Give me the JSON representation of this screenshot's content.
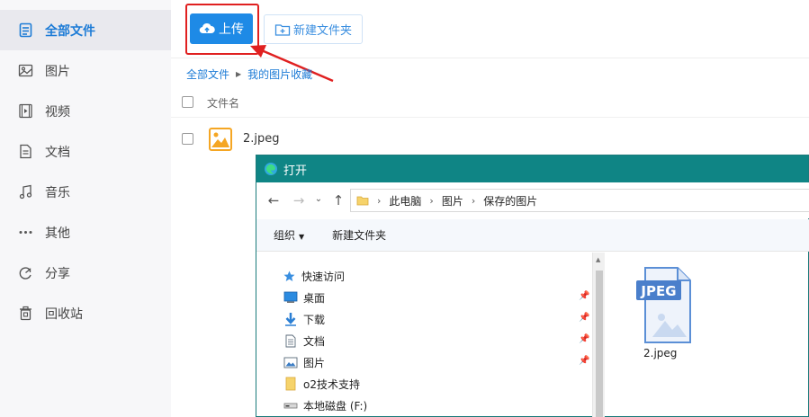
{
  "sidebar": {
    "items": [
      {
        "label": "全部文件",
        "icon": "document-icon",
        "active": true
      },
      {
        "label": "图片",
        "icon": "image-icon"
      },
      {
        "label": "视频",
        "icon": "video-icon"
      },
      {
        "label": "文档",
        "icon": "file-text-icon"
      },
      {
        "label": "音乐",
        "icon": "music-icon"
      },
      {
        "label": "其他",
        "icon": "more-icon"
      },
      {
        "label": "分享",
        "icon": "share-icon"
      },
      {
        "label": "回收站",
        "icon": "trash-icon"
      }
    ]
  },
  "toolbar": {
    "upload_label": "上传",
    "new_folder_label": "新建文件夹"
  },
  "breadcrumb": [
    "全部文件",
    "我的图片收藏"
  ],
  "file_list": {
    "column_name": "文件名",
    "files": [
      {
        "name": "2.jpeg"
      }
    ]
  },
  "dialog": {
    "title": "打开",
    "address": [
      "此电脑",
      "图片",
      "保存的图片"
    ],
    "commands": {
      "organize": "组织",
      "new_folder": "新建文件夹"
    },
    "quick_access": "快速访问",
    "nav_items": [
      {
        "label": "桌面",
        "pinned": true
      },
      {
        "label": "下载",
        "pinned": true
      },
      {
        "label": "文档",
        "pinned": true
      },
      {
        "label": "图片",
        "pinned": true
      },
      {
        "label": "o2技术支持",
        "pinned": false
      },
      {
        "label": "本地磁盘 (F:)",
        "pinned": false
      }
    ],
    "file": {
      "name": "2.jpeg",
      "badge": "JPEG"
    }
  },
  "colors": {
    "accent": "#1e8ae6",
    "highlight": "#e02020",
    "dialog_title": "#0f8585"
  }
}
